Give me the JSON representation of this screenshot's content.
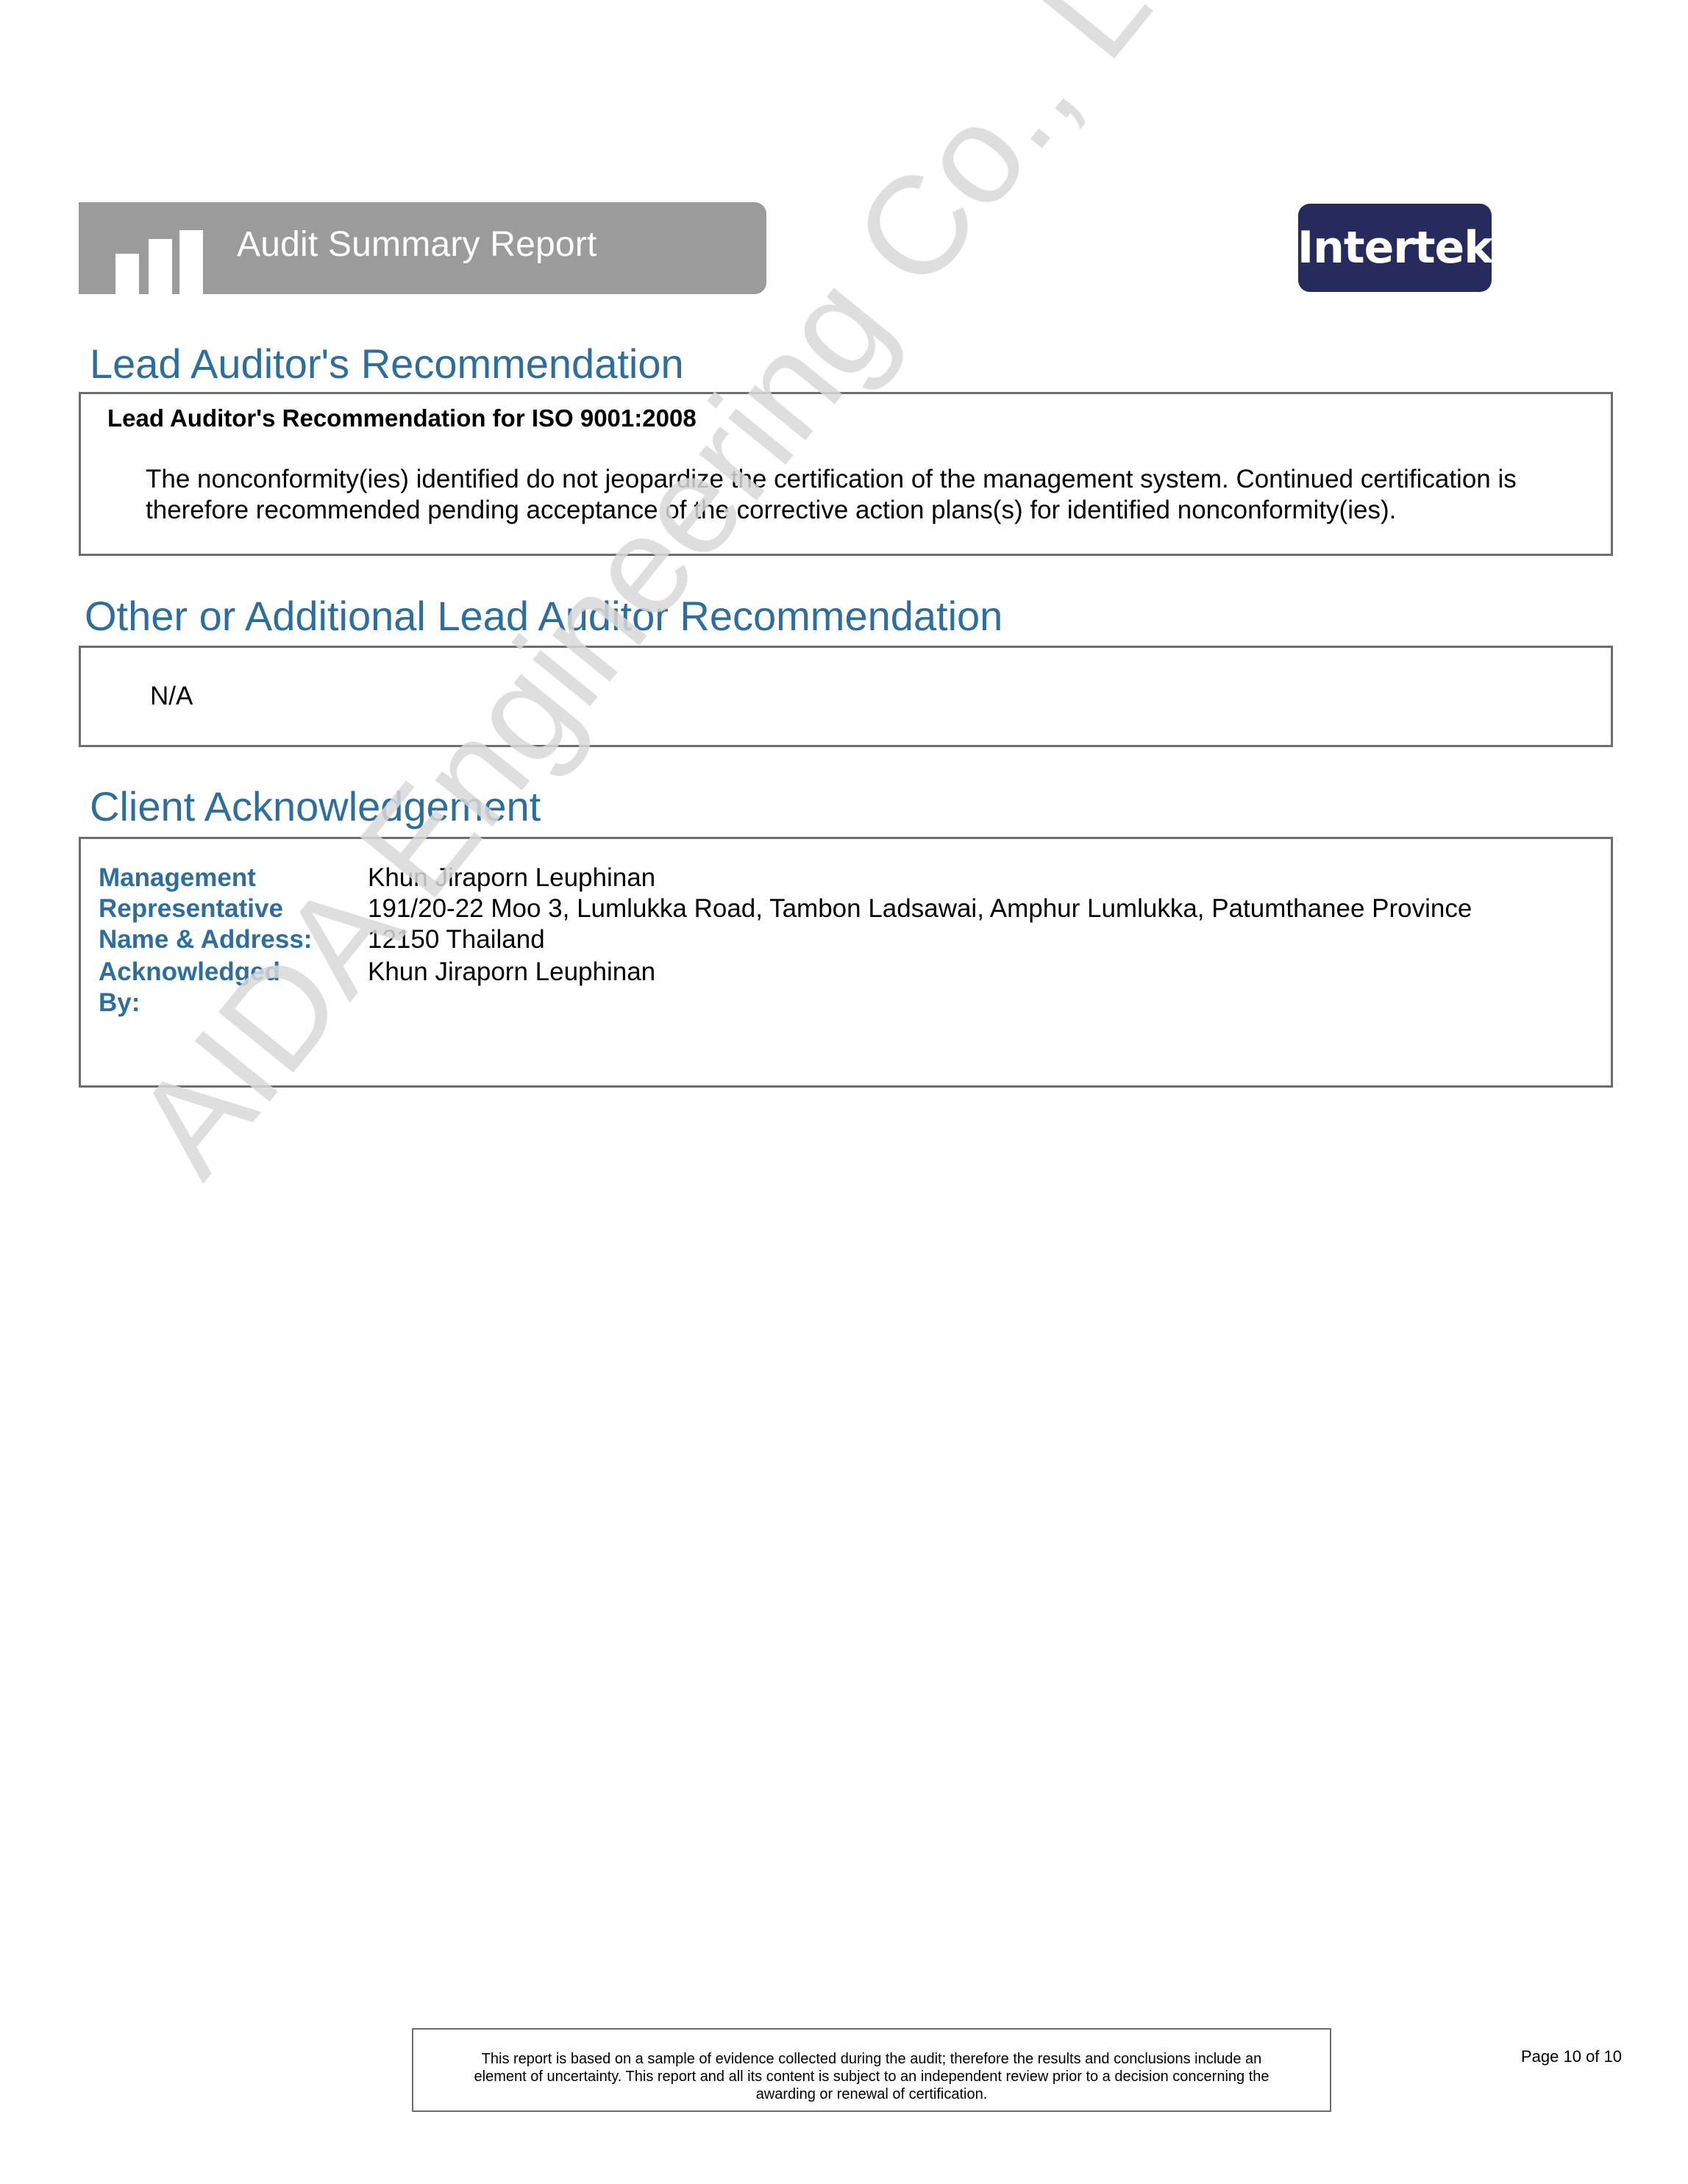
{
  "header": {
    "banner_title": "Audit Summary Report",
    "logo_text": "Intertek",
    "logo_color": "#262a5c",
    "banner_color": "#9b9b9b",
    "accent_color": "#2e6e9e"
  },
  "sections": {
    "lead_recommendation": {
      "title": "Lead Auditor's Recommendation",
      "subheading": "Lead Auditor's Recommendation for ISO 9001:2008",
      "text": "The nonconformity(ies) identified do not jeopardize the certification of the management system. Continued certification is therefore recommended pending acceptance of the corrective action plans(s) for identified nonconformity(ies)."
    },
    "additional_recommendation": {
      "title": "Other or Additional Lead Auditor Recommendation",
      "text": "N/A"
    },
    "client_acknowledgement": {
      "title": "Client Acknowledgement",
      "management_label_lines": [
        "Management",
        "Representative",
        "Name & Address:"
      ],
      "management_value_lines": [
        "Khun Jiraporn Leuphinan",
        "191/20-22 Moo 3, Lumlukka Road, Tambon Ladsawai, Amphur Lumlukka, Patumthanee Province",
        "12150 Thailand"
      ],
      "acknowledged_label_lines": [
        "Acknowledged",
        "By:"
      ],
      "acknowledged_value": "Khun Jiraporn Leuphinan"
    }
  },
  "watermark": "AIDA Engineering Co., Ltd.",
  "footer": {
    "disclaimer_lines": [
      "This report is based on a sample of evidence collected during the audit; therefore the results and conclusions include an",
      "element of uncertainty.  This report and all its content is subject to an independent review prior to a decision concerning the",
      "awarding or renewal of certification."
    ],
    "page": "Page 10 of 10"
  }
}
